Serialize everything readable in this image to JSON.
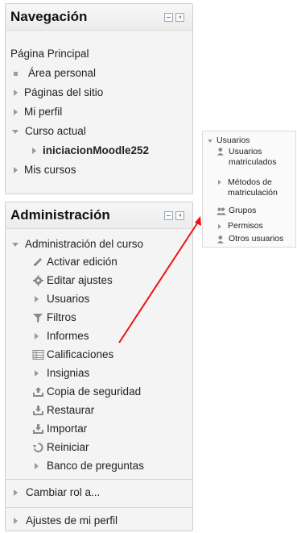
{
  "navegacion": {
    "title": "Navegación",
    "items": [
      {
        "label": "Página Principal"
      },
      {
        "label": "Área personal"
      },
      {
        "label": "Páginas del sitio"
      },
      {
        "label": "Mi perfil"
      },
      {
        "label": "Curso actual"
      },
      {
        "label": "iniciacionMoodle252"
      },
      {
        "label": "Mis cursos"
      }
    ]
  },
  "administracion": {
    "title": "Administración",
    "course_admin": "Administración del curso",
    "items": [
      {
        "label": "Activar edición",
        "icon": "pencil-icon"
      },
      {
        "label": "Editar ajustes",
        "icon": "gear-icon"
      },
      {
        "label": "Usuarios",
        "icon": "expand-arrow-icon"
      },
      {
        "label": "Filtros",
        "icon": "filter-icon"
      },
      {
        "label": "Informes",
        "icon": "expand-arrow-icon"
      },
      {
        "label": "Calificaciones",
        "icon": "grades-table-icon"
      },
      {
        "label": "Insignias",
        "icon": "expand-arrow-icon"
      },
      {
        "label": "Copia de seguridad",
        "icon": "backup-upload-icon"
      },
      {
        "label": "Restaurar",
        "icon": "restore-download-icon"
      },
      {
        "label": "Importar",
        "icon": "import-download-icon"
      },
      {
        "label": "Reiniciar",
        "icon": "reset-circular-arrow-icon"
      },
      {
        "label": "Banco de preguntas",
        "icon": "expand-arrow-icon"
      }
    ],
    "switch_role": "Cambiar rol a...",
    "profile_settings": "Ajustes de mi perfil"
  },
  "usuarios_panel": {
    "title": "Usuarios",
    "items": [
      {
        "label": "Usuarios matriculados",
        "line1": "Usuarios",
        "line2": "matriculados"
      },
      {
        "label": "Métodos de matriculación",
        "line1": "Métodos de",
        "line2": "matriculación"
      },
      {
        "label": "Grupos"
      },
      {
        "label": "Permisos"
      },
      {
        "label": "Otros usuarios"
      }
    ]
  },
  "colors": {
    "arrow": "#ee1111",
    "border": "#cfcfcf",
    "text": "#222222"
  }
}
